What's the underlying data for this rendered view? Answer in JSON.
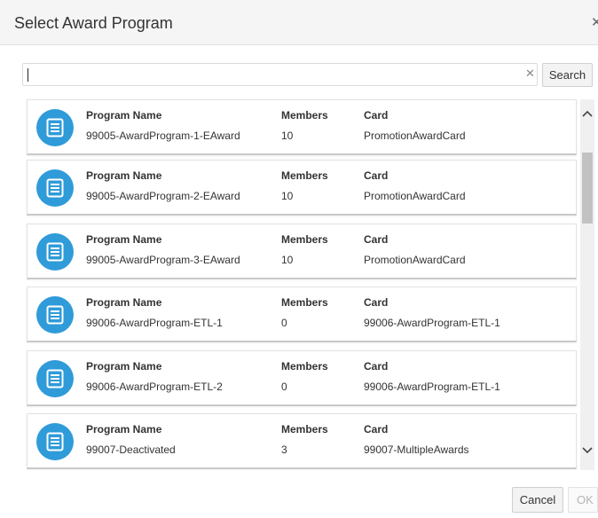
{
  "dialog": {
    "title": "Select Award Program",
    "close_icon": "close-icon"
  },
  "search": {
    "value": "",
    "clear_icon": "clear-icon",
    "button_label": "Search"
  },
  "columns": {
    "name": "Program Name",
    "members": "Members",
    "card": "Card"
  },
  "programs": [
    {
      "name": "99005-AwardProgram-1-EAward",
      "members": "10",
      "card": "PromotionAwardCard"
    },
    {
      "name": "99005-AwardProgram-2-EAward",
      "members": "10",
      "card": "PromotionAwardCard"
    },
    {
      "name": "99005-AwardProgram-3-EAward",
      "members": "10",
      "card": "PromotionAwardCard"
    },
    {
      "name": "99006-AwardProgram-ETL-1",
      "members": "0",
      "card": "99006-AwardProgram-ETL-1"
    },
    {
      "name": "99006-AwardProgram-ETL-2",
      "members": "0",
      "card": "99006-AwardProgram-ETL-1"
    },
    {
      "name": "99007-Deactivated",
      "members": "3",
      "card": "99007-MultipleAwards"
    }
  ],
  "footer": {
    "cancel_label": "Cancel",
    "ok_label": "OK"
  },
  "colors": {
    "icon_background": "#2f9bd9",
    "header_background": "#f5f5f5"
  }
}
